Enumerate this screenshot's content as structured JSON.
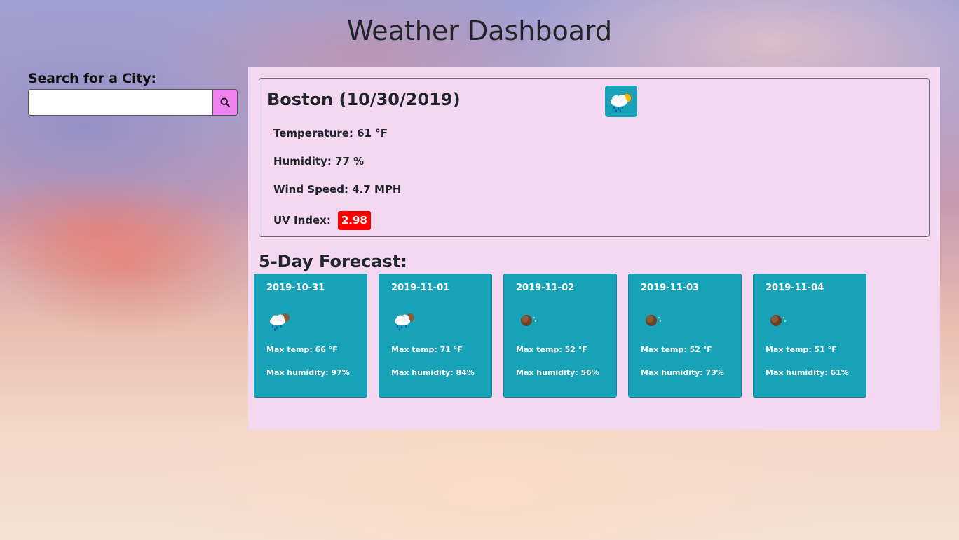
{
  "header": {
    "title": "Weather Dashboard"
  },
  "search": {
    "label": "Search for a City:",
    "value": "",
    "button_icon": "search-icon"
  },
  "current": {
    "city_date": "Boston (10/30/2019)",
    "icon": "rain-sun-cloud-icon",
    "temperature": "Temperature: 61 °F",
    "humidity": "Humidity: 77 %",
    "wind": "Wind Speed: 4.7 MPH",
    "uv_label": "UV Index:",
    "uv_value": "2.98",
    "uv_color": "#ff0000"
  },
  "forecast": {
    "title": "5-Day Forecast:",
    "days": [
      {
        "date": "2019-10-31",
        "icon": "rain-cloud-icon",
        "max_temp": "Max temp: 66 °F",
        "max_humidity": "Max humidity: 97%"
      },
      {
        "date": "2019-11-01",
        "icon": "rain-cloud-icon",
        "max_temp": "Max temp: 71 °F",
        "max_humidity": "Max humidity: 84%"
      },
      {
        "date": "2019-11-02",
        "icon": "clear-night-icon",
        "max_temp": "Max temp: 52 °F",
        "max_humidity": "Max humidity: 56%"
      },
      {
        "date": "2019-11-03",
        "icon": "clear-night-icon",
        "max_temp": "Max temp: 52 °F",
        "max_humidity": "Max humidity: 73%"
      },
      {
        "date": "2019-11-04",
        "icon": "clear-night-icon",
        "max_temp": "Max temp: 51 °F",
        "max_humidity": "Max humidity: 61%"
      }
    ]
  },
  "colors": {
    "panel": "#f4d8f2",
    "card": "#17a2b8",
    "search_button": "#ee82ee"
  }
}
